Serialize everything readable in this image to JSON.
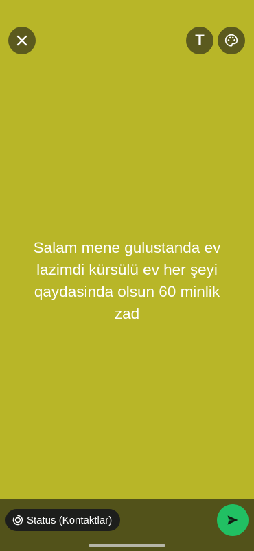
{
  "editor": {
    "background_color": "#b8b628",
    "status_text": "Salam mene gulustanda ev\nlazimdi kürsülü ev her şeyi\nqaydasinda olsun 60 minlik\nzad"
  },
  "toolbar": {
    "close_icon": "close-icon",
    "text_tool_label": "T",
    "palette_icon": "palette-icon"
  },
  "footer": {
    "audience_label": "Status (Kontaktlar)",
    "audience_icon": "status-icon",
    "send_icon": "send-icon",
    "send_color": "#21c063"
  }
}
